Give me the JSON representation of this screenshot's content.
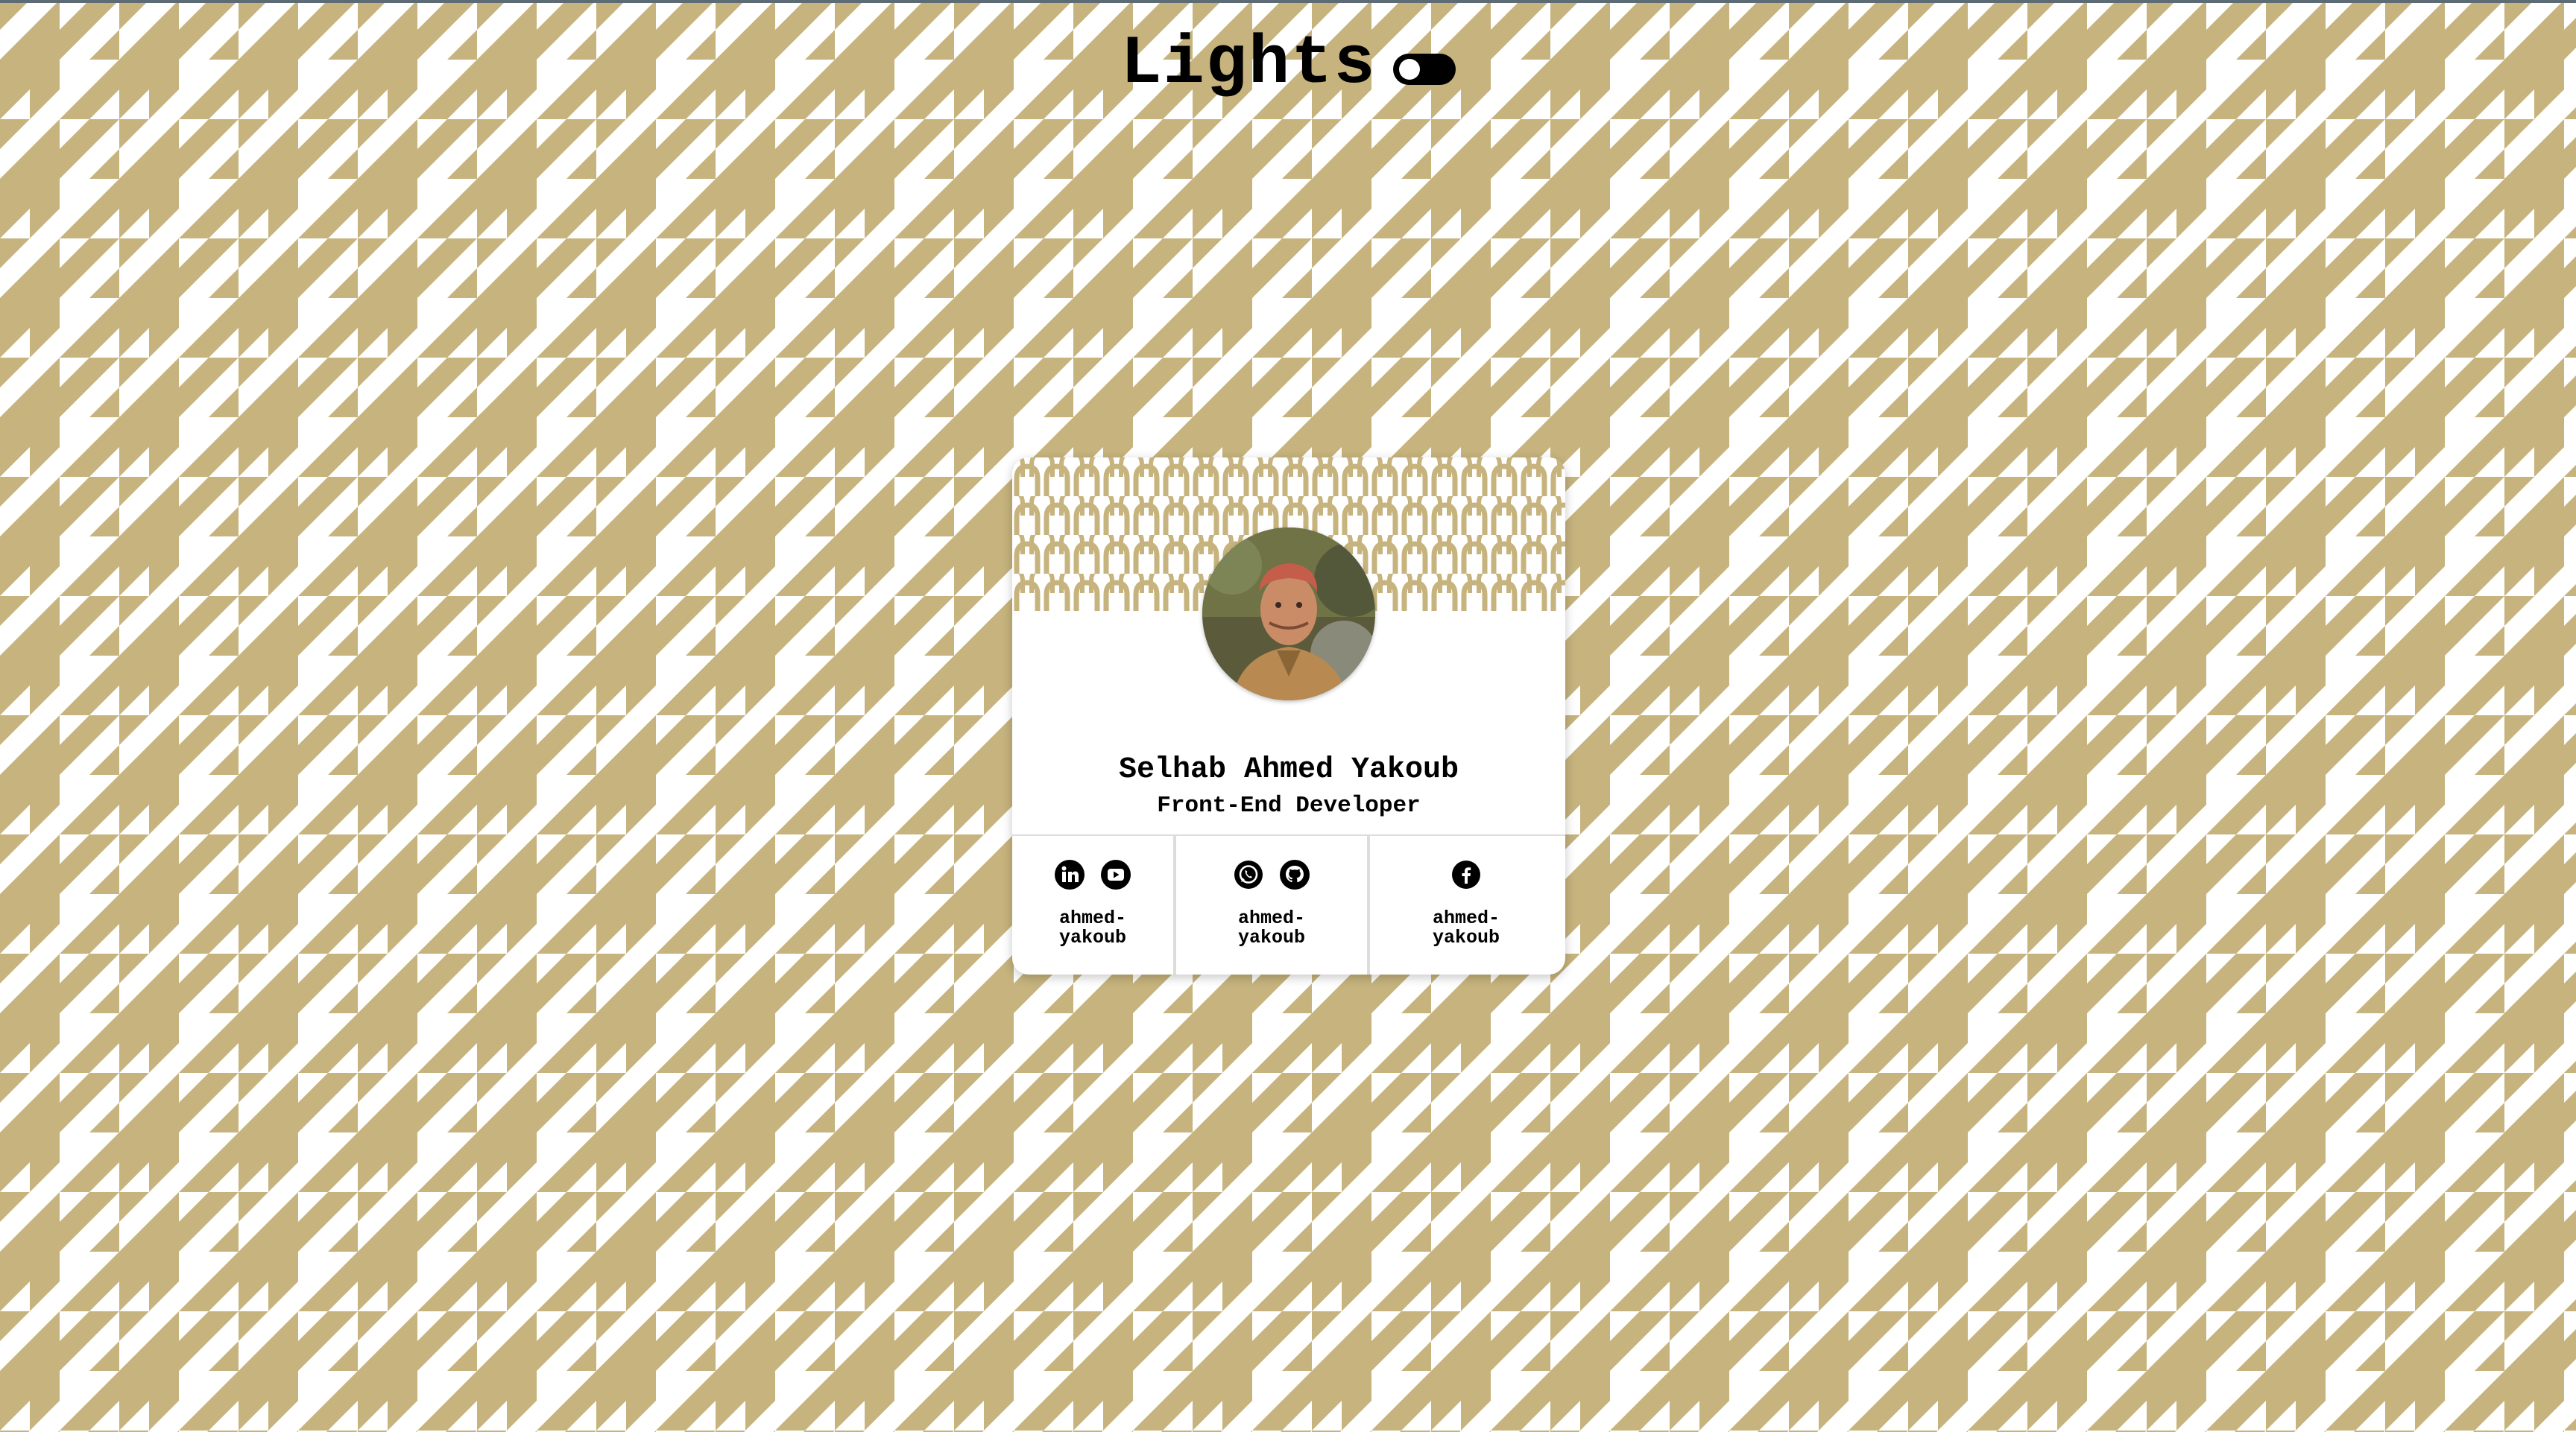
{
  "header": {
    "title": "Lights",
    "toggle_state": "dark-off"
  },
  "theme": {
    "pattern_color": "#c6b37d",
    "background": "#ffffff",
    "text_color": "#000000"
  },
  "profile": {
    "name": "Selhab Ahmed Yakoub",
    "role": "Front-End Developer",
    "avatar_alt": "profile photo"
  },
  "socials": [
    {
      "icons": [
        "linkedin-icon",
        "youtube-icon"
      ],
      "handle_line1": "ahmed-",
      "handle_line2": "yakoub"
    },
    {
      "icons": [
        "whatsapp-icon",
        "github-icon"
      ],
      "handle_line1": "ahmed-",
      "handle_line2": "yakoub"
    },
    {
      "icons": [
        "facebook-icon"
      ],
      "handle_line1": "ahmed-",
      "handle_line2": "yakoub"
    }
  ]
}
